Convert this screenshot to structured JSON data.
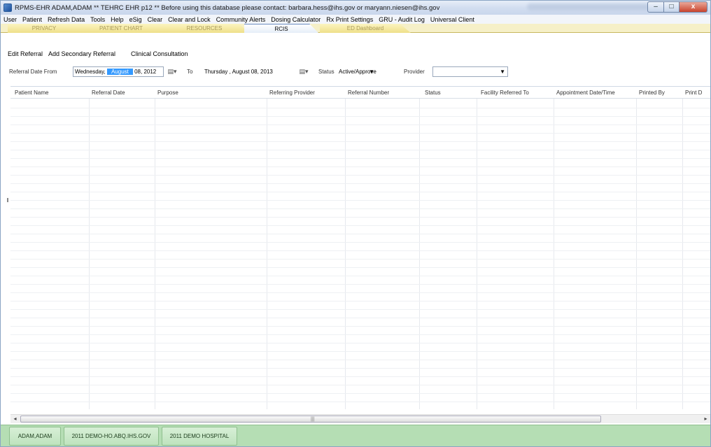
{
  "window": {
    "title": "RPMS-EHR ADAM,ADAM   ** TEHRC EHR p12 **  Before using this database please contact:  barbara.hess@ihs.gov or maryann.niesen@ihs.gov",
    "minimize_glyph": "–",
    "maximize_glyph": "□",
    "close_glyph": "x",
    "icon": "app-icon"
  },
  "menu": [
    "User",
    "Patient",
    "Refresh Data",
    "Tools",
    "Help",
    "eSig",
    "Clear",
    "Clear and Lock",
    "Community Alerts",
    "Dosing Calculator",
    "Rx Print Settings",
    "GRU - Audit Log",
    "Universal Client"
  ],
  "tabs": [
    {
      "label": "PRIVACY",
      "active": false
    },
    {
      "label": "PATIENT CHART",
      "active": false
    },
    {
      "label": "RESOURCES",
      "active": false
    },
    {
      "label": "RCIS",
      "active": true
    },
    {
      "label": "ED Dashboard",
      "active": false
    }
  ],
  "actions": {
    "edit_referral": "Edit Referral",
    "add_secondary_referral": "Add Secondary Referral",
    "clinical_consultation": "Clinical Consultation"
  },
  "filters": {
    "from_label": "Referral Date From",
    "from_day": "Wednesday,",
    "from_month": "August",
    "from_rest": "08, 2012",
    "to_label": "To",
    "to_value": "Thursday  ,   August   08, 2013",
    "status_label": "Status",
    "status_value": "Active/Approve",
    "provider_label": "Provider",
    "provider_value": "",
    "calendar_glyph": "▤▾",
    "dropdown_glyph": "▼"
  },
  "grid": {
    "columns": [
      "Patient Name",
      "Referral Date",
      "Purpose",
      "Referring Provider",
      "Referral Number",
      "Status",
      "Facility Referred To",
      "Appointment Date/Time",
      "Printed By",
      "Print D"
    ]
  },
  "scrollbar": {
    "left_arrow": "◂",
    "right_arrow": "▸",
    "grip": "|||"
  },
  "status_bar": {
    "user": "ADAM,ADAM",
    "server": "2011 DEMO-HO.ABQ.IHS.GOV",
    "facility": "2011 DEMO HOSPITAL"
  },
  "colors": {
    "status_bar": "#b5deb4",
    "tab_inactive": "#efe08a",
    "selection": "#3399ff"
  }
}
